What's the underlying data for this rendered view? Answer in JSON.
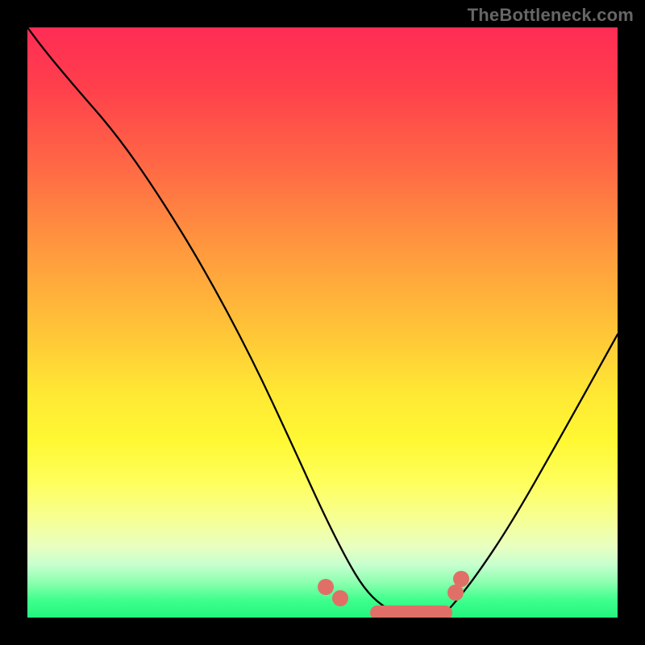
{
  "watermark": "TheBottleneck.com",
  "colors": {
    "page_bg": "#000000",
    "curve": "#000000",
    "valley_marker": "#e07067",
    "gradient_top": "#ff2c55",
    "gradient_bottom": "#23f57e",
    "watermark": "#666666"
  },
  "chart_data": {
    "type": "line",
    "title": "",
    "xlabel": "",
    "ylabel": "",
    "xlim": [
      0,
      100
    ],
    "ylim": [
      0,
      100
    ],
    "grid": false,
    "legend": "none",
    "note": "Values read off the image in percent of plot area; no axes or tick labels are shown.",
    "series": [
      {
        "name": "bottleneck-curve",
        "x": [
          0,
          3,
          8,
          15,
          22,
          30,
          38,
          45,
          50,
          54,
          57,
          60,
          64,
          70,
          72,
          76,
          82,
          90,
          100
        ],
        "y": [
          100,
          96,
          90,
          82,
          72,
          59,
          44,
          29,
          18,
          10,
          5,
          2,
          0,
          0,
          2,
          7,
          16,
          30,
          48
        ],
        "note": "y = 0 is the valley floor (bottom of plot), y = 100 is top"
      }
    ],
    "valley_markers": {
      "color": "#e07067",
      "band": {
        "x_start": 58,
        "x_end": 72,
        "y": 0.8
      },
      "dots": [
        {
          "x": 50.5,
          "y": 5.2
        },
        {
          "x": 53.0,
          "y": 3.3
        },
        {
          "x": 72.5,
          "y": 4.2
        },
        {
          "x": 73.5,
          "y": 6.5
        }
      ]
    }
  }
}
